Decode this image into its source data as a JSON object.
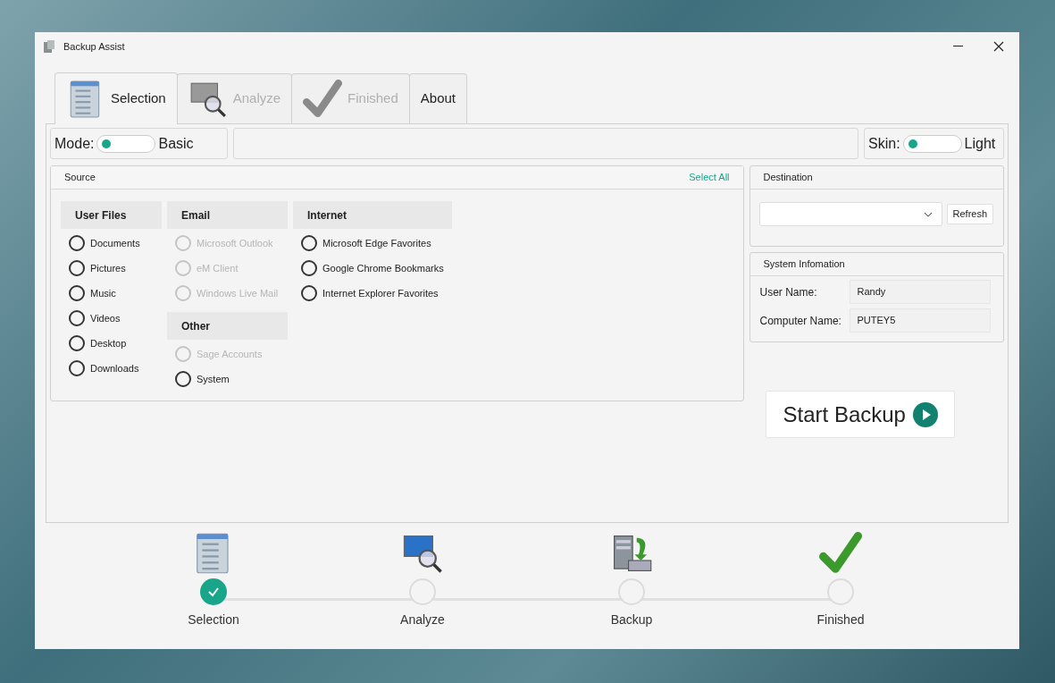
{
  "window": {
    "title": "Backup Assist"
  },
  "tabs": [
    {
      "label": "Selection",
      "kind": "list",
      "selected": true,
      "disabled": false
    },
    {
      "label": "Analyze",
      "kind": "monitor",
      "selected": false,
      "disabled": true
    },
    {
      "label": "Finished",
      "kind": "check",
      "selected": false,
      "disabled": true
    },
    {
      "label": "About",
      "kind": "text",
      "selected": false,
      "disabled": false
    }
  ],
  "mode": {
    "label": "Mode:",
    "value": "Basic",
    "on": false
  },
  "skin": {
    "label": "Skin:",
    "value": "Light",
    "on": false
  },
  "source": {
    "title": "Source",
    "select_all": "Select All",
    "columns": [
      [
        {
          "title": "User Files",
          "items": [
            {
              "label": "Documents",
              "checked": false,
              "disabled": false
            },
            {
              "label": "Pictures",
              "checked": false,
              "disabled": false
            },
            {
              "label": "Music",
              "checked": false,
              "disabled": false
            },
            {
              "label": "Videos",
              "checked": false,
              "disabled": false
            },
            {
              "label": "Desktop",
              "checked": false,
              "disabled": false
            },
            {
              "label": "Downloads",
              "checked": false,
              "disabled": false
            }
          ]
        }
      ],
      [
        {
          "title": "Email",
          "items": [
            {
              "label": "Microsoft Outlook",
              "checked": false,
              "disabled": true
            },
            {
              "label": "eM Client",
              "checked": false,
              "disabled": true
            },
            {
              "label": "Windows Live Mail",
              "checked": false,
              "disabled": true
            }
          ]
        },
        {
          "title": "Other",
          "items": [
            {
              "label": "Sage Accounts",
              "checked": false,
              "disabled": true
            },
            {
              "label": "System",
              "checked": false,
              "disabled": false
            }
          ]
        }
      ],
      [
        {
          "title": "Internet",
          "items": [
            {
              "label": "Microsoft Edge Favorites",
              "checked": false,
              "disabled": false
            },
            {
              "label": "Google Chrome Bookmarks",
              "checked": false,
              "disabled": false
            },
            {
              "label": "Internet Explorer Favorites",
              "checked": false,
              "disabled": false
            }
          ]
        }
      ]
    ]
  },
  "destination": {
    "title": "Destination",
    "refresh": "Refresh"
  },
  "system_info": {
    "title": "System Infomation",
    "fields": [
      {
        "label": "User Name:",
        "value": "Randy"
      },
      {
        "label": "Computer Name:",
        "value": "PUTEY5"
      }
    ]
  },
  "start_button": "Start Backup",
  "steps": [
    {
      "label": "Selection",
      "kind": "list",
      "done": true
    },
    {
      "label": "Analyze",
      "kind": "monitor",
      "done": false
    },
    {
      "label": "Backup",
      "kind": "server",
      "done": false
    },
    {
      "label": "Finished",
      "kind": "check",
      "done": false
    }
  ]
}
